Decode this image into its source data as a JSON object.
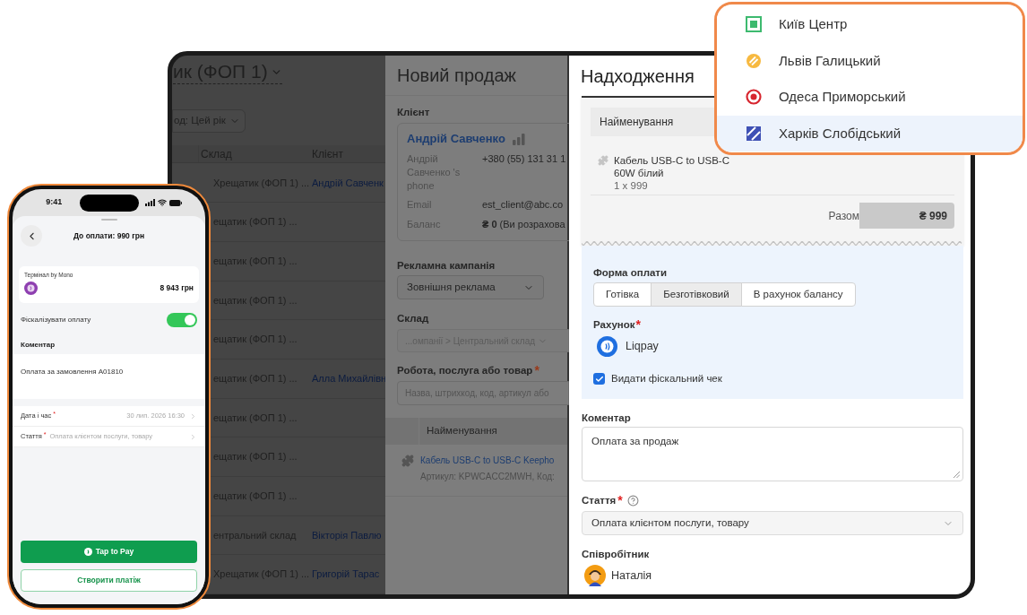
{
  "background_page": {
    "title": "ик (ФОП 1)",
    "filter": "од: Цей рік",
    "columns": [
      "Склад",
      "Клієнт"
    ],
    "rows": [
      {
        "warehouse": "Хрещатик (ФОП 1) ...",
        "client": "Андрій Савченк"
      },
      {
        "warehouse": "ещатик (ФОП 1) ..."
      },
      {
        "warehouse": "ещатик (ФОП 1) ..."
      },
      {
        "warehouse": "ещатик (ФОП 1) ..."
      },
      {
        "warehouse": "ещатик (ФОП 1) ..."
      },
      {
        "warehouse": "ещатик (ФОП 1) ...",
        "client": "Алла Михайлівн"
      },
      {
        "warehouse": "ещатик (ФОП 1) ..."
      },
      {
        "warehouse": "ещатик (ФОП 1) ..."
      },
      {
        "warehouse": "ещатик (ФОП 1) ..."
      },
      {
        "warehouse": "ентральний склад",
        "client": "Вікторія Павлю"
      },
      {
        "warehouse": "Хрещатик (ФОП 1) ...",
        "client": "Григорій Тарас"
      }
    ]
  },
  "new_sale_panel": {
    "title": "Новий продаж",
    "client": {
      "label": "Клієнт",
      "name": "Андрій Савченко",
      "details": [
        {
          "label": "Андрій Савченко 's phone",
          "value": "+380 (55) 131 31 1"
        },
        {
          "label": "Email",
          "value": "est_client@abc.co"
        },
        {
          "label": "Баланс",
          "value": "**₴ 0** (Ви розрахова"
        }
      ]
    },
    "campaign": {
      "label": "Рекламна кампанія",
      "value": "Зовнішня реклама"
    },
    "warehouse": {
      "label": "Склад",
      "value": "...омпанії > Центральний склад",
      "disabled": true
    },
    "product": {
      "label": "Робота, послуга або товар",
      "required_mark": "*",
      "placeholder": "Назва, штрихкод, код, артикул або"
    },
    "table": {
      "column": "Найменування",
      "item": {
        "name": "Кабель USB-C to USB-C Keepho",
        "details": "Артикул: KPWCACC2MWH, Код:"
      }
    }
  },
  "receipt_panel": {
    "title": "Надходження",
    "receipt": {
      "column": "Найменування",
      "item": {
        "name": "Кабель USB-C to USB-C",
        "name_line_2": "60W білий",
        "quantity": "1 x 999"
      },
      "total_label": "Разом",
      "total": "₴ 999"
    },
    "payment": {
      "label": "Форма оплати",
      "methods": [
        {
          "label": "Готівка",
          "selected": false
        },
        {
          "label": "Безготівковий",
          "selected": true
        },
        {
          "label": "В рахунок балансу",
          "selected": false
        }
      ],
      "account": {
        "label": "Рахунок",
        "required_mark": "*",
        "value": "Liqpay"
      },
      "fiscal_receipt": {
        "label": "Видати фіскальний чек",
        "checked": true
      }
    },
    "comment": {
      "label": "Коментар",
      "value": "Оплата за продаж"
    },
    "article": {
      "label": "Стаття",
      "required_mark": "*",
      "value": "Оплата клієнтом послуги, товару"
    },
    "employee": {
      "label": "Співробітник",
      "name": "Наталія"
    }
  },
  "location_menu": {
    "items": [
      {
        "label": "Київ Центр",
        "kind": "square",
        "color": "#3dba6f",
        "selected": false
      },
      {
        "label": "Львів Галицький",
        "kind": "striped-circle",
        "color": "#f7b940",
        "selected": false
      },
      {
        "label": "Одеса Приморський",
        "kind": "target",
        "color": "#d7262f",
        "selected": false
      },
      {
        "label": "Харків Слобідський",
        "kind": "striped-square",
        "color": "#3f51b5",
        "selected": true
      }
    ]
  },
  "phone": {
    "time": "9:41",
    "title": "До оплати: 990 грн",
    "terminal": {
      "label": "Термінал by Mono",
      "amount": "8 943 грн"
    },
    "fiscalize": {
      "label": "Фіскалізувати оплату",
      "on": true
    },
    "comment": {
      "label": "Коментар",
      "value": "Оплата за замовлення A01810"
    },
    "fields": [
      {
        "label": "Дата і час",
        "required_mark": "*",
        "value": "30 лип. 2026 16:30"
      },
      {
        "label": "Стаття",
        "required_mark": "*",
        "value": "Оплата клієнтом послуги, товару"
      }
    ],
    "buttons": [
      {
        "label": "Tap to Pay",
        "kind": "primary"
      },
      {
        "label": "Створити платіж",
        "kind": "secondary"
      }
    ]
  }
}
